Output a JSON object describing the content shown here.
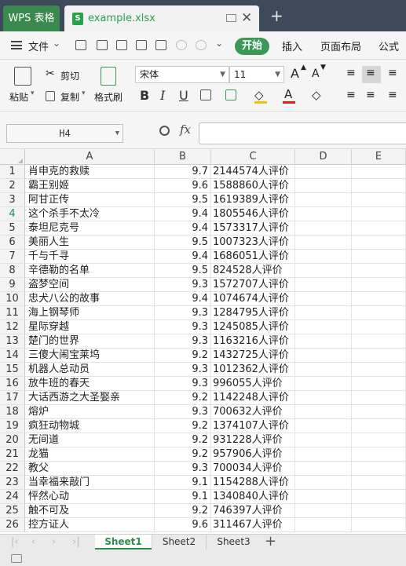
{
  "titlebar": {
    "home_tab": "WPS 表格",
    "file_tab": "example.xlsx",
    "file_icon": "xls-file-icon",
    "new_tab": "+"
  },
  "menubar": {
    "file_menu": "文件",
    "start": "开始",
    "insert": "插入",
    "page_layout": "页面布局",
    "formula": "公式"
  },
  "ribbon": {
    "paste": "粘贴",
    "cut": "剪切",
    "copy": "复制",
    "format_painter": "格式刷",
    "font_name": "宋体",
    "font_size": "11",
    "bold": "B",
    "italic": "I",
    "underline": "U",
    "increase_font": "A",
    "decrease_font": "A"
  },
  "formula_bar": {
    "cell_ref": "H4",
    "fx": "fx",
    "value": ""
  },
  "columns": [
    "A",
    "B",
    "C",
    "D",
    "E"
  ],
  "active_row": 4,
  "rows": [
    {
      "n": "1",
      "a": "肖申克的救赎",
      "b": "9.7",
      "c": "2144574人评价"
    },
    {
      "n": "2",
      "a": "霸王别姬",
      "b": "9.6",
      "c": "1588860人评价"
    },
    {
      "n": "3",
      "a": "阿甘正传",
      "b": "9.5",
      "c": "1619389人评价"
    },
    {
      "n": "4",
      "a": "这个杀手不太冷",
      "b": "9.4",
      "c": "1805546人评价"
    },
    {
      "n": "5",
      "a": "泰坦尼克号",
      "b": "9.4",
      "c": "1573317人评价"
    },
    {
      "n": "6",
      "a": "美丽人生",
      "b": "9.5",
      "c": "1007323人评价"
    },
    {
      "n": "7",
      "a": "千与千寻",
      "b": "9.4",
      "c": "1686051人评价"
    },
    {
      "n": "8",
      "a": "辛德勒的名单",
      "b": "9.5",
      "c": "824528人评价"
    },
    {
      "n": "9",
      "a": "盗梦空间",
      "b": "9.3",
      "c": "1572707人评价"
    },
    {
      "n": "10",
      "a": "忠犬八公的故事",
      "b": "9.4",
      "c": "1074674人评价"
    },
    {
      "n": "11",
      "a": "海上钢琴师",
      "b": "9.3",
      "c": "1284795人评价"
    },
    {
      "n": "12",
      "a": "星际穿越",
      "b": "9.3",
      "c": "1245085人评价"
    },
    {
      "n": "13",
      "a": "楚门的世界",
      "b": "9.3",
      "c": "1163216人评价"
    },
    {
      "n": "14",
      "a": "三傻大闹宝莱坞",
      "b": "9.2",
      "c": "1432725人评价"
    },
    {
      "n": "15",
      "a": "机器人总动员",
      "b": "9.3",
      "c": "1012362人评价"
    },
    {
      "n": "16",
      "a": "放牛班的春天",
      "b": "9.3",
      "c": "996055人评价"
    },
    {
      "n": "17",
      "a": "大话西游之大圣娶亲",
      "b": "9.2",
      "c": "1142248人评价"
    },
    {
      "n": "18",
      "a": "熔炉",
      "b": "9.3",
      "c": "700632人评价"
    },
    {
      "n": "19",
      "a": "疯狂动物城",
      "b": "9.2",
      "c": "1374107人评价"
    },
    {
      "n": "20",
      "a": "无间道",
      "b": "9.2",
      "c": "931228人评价"
    },
    {
      "n": "21",
      "a": "龙猫",
      "b": "9.2",
      "c": "957906人评价"
    },
    {
      "n": "22",
      "a": "教父",
      "b": "9.3",
      "c": "700034人评价"
    },
    {
      "n": "23",
      "a": "当幸福来敲门",
      "b": "9.1",
      "c": "1154288人评价"
    },
    {
      "n": "24",
      "a": "怦然心动",
      "b": "9.1",
      "c": "1340840人评价"
    },
    {
      "n": "25",
      "a": "触不可及",
      "b": "9.2",
      "c": "746397人评价"
    },
    {
      "n": "26",
      "a": "控方证人",
      "b": "9.6",
      "c": "311467人评价"
    }
  ],
  "sheets": [
    "Sheet1",
    "Sheet2",
    "Sheet3"
  ],
  "active_sheet": "Sheet1",
  "colors": {
    "accent": "#2d8c4a",
    "titlebar": "#3d4a5a",
    "home_tab": "#3a8a50",
    "start_button": "#3a9a55"
  }
}
